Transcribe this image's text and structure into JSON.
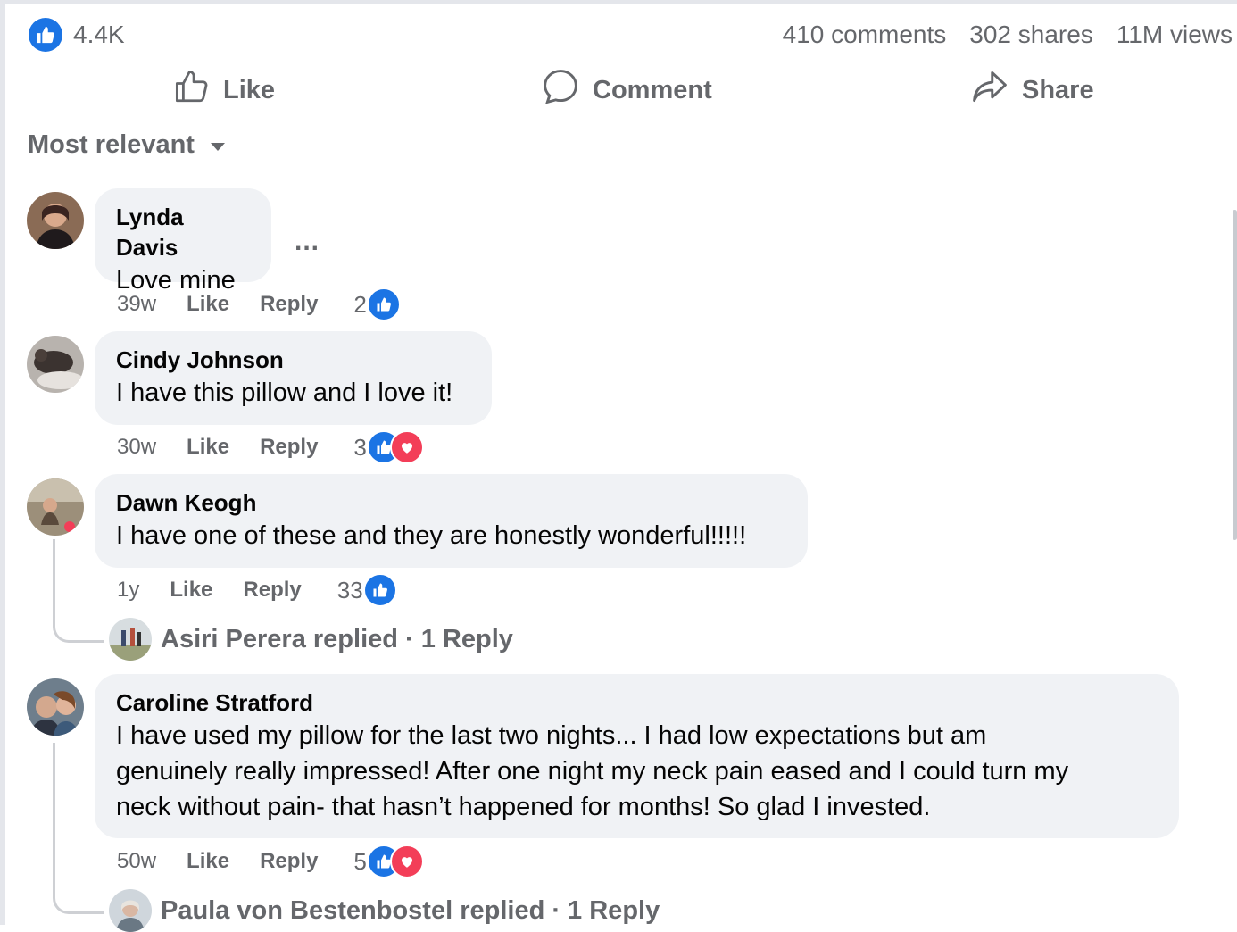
{
  "stats": {
    "reactions_count": "4.4K",
    "comments": "410 comments",
    "shares": "302 shares",
    "views": "11M views"
  },
  "actions": {
    "like": "Like",
    "comment": "Comment",
    "share": "Share"
  },
  "sort": {
    "label": "Most relevant"
  },
  "comments": [
    {
      "author": "Lynda Davis",
      "text": "Love mine",
      "time": "39w",
      "like": "Like",
      "reply": "Reply",
      "reaction_count": "2",
      "reactions": [
        "like"
      ],
      "more": "..."
    },
    {
      "author": "Cindy Johnson",
      "text": "I have this pillow and I love it!",
      "time": "30w",
      "like": "Like",
      "reply": "Reply",
      "reaction_count": "3",
      "reactions": [
        "like",
        "love"
      ]
    },
    {
      "author": "Dawn Keogh",
      "text": "I have one of these and they are honestly wonderful!!!!!",
      "time": "1y",
      "like": "Like",
      "reply": "Reply",
      "reaction_count": "33",
      "reactions": [
        "like"
      ],
      "replied": "Asiri Perera replied · 1 Reply"
    },
    {
      "author": "Caroline Stratford",
      "text_lines": [
        "I have used my pillow for the last two nights... I had low expectations but am",
        "genuinely really impressed! After one night my neck pain eased and I could turn my",
        "neck without pain- that hasn’t happened for months! So glad I invested."
      ],
      "time": "50w",
      "like": "Like",
      "reply": "Reply",
      "reaction_count": "5",
      "reactions": [
        "like",
        "love"
      ],
      "replied": "Paula von Bestenbostel replied · 1 Reply"
    }
  ],
  "colors": {
    "accent": "#1b74e4",
    "love": "#f33e58",
    "muted_text": "#65676b",
    "bubble": "#f0f2f5"
  },
  "icons": [
    "like-icon",
    "comment-icon",
    "share-icon",
    "caret-down-icon",
    "love-icon"
  ]
}
